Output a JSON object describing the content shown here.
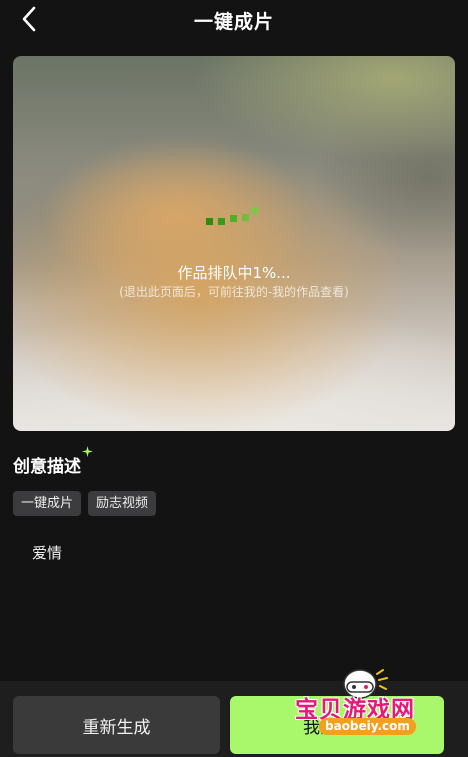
{
  "header": {
    "title": "一键成片",
    "back_icon": "chevron-left-icon"
  },
  "preview": {
    "status_text": "作品排队中1%...",
    "hint_text": "(退出此页面后，可前往我的-我的作品查看)",
    "progress_percent": 1,
    "loader_color": "#4caf24"
  },
  "creative": {
    "title": "创意描述",
    "sparkle_color": "#a9f76b",
    "tags": [
      "一键成片",
      "励志视频"
    ],
    "description": "爱情"
  },
  "actions": {
    "regenerate_label": "重新生成",
    "my_works_label": "我的作品"
  },
  "watermark": {
    "text": "宝贝游戏网",
    "url": "baobeiy.com"
  },
  "colors": {
    "background": "#131313",
    "accent": "#a9f76b",
    "watermark_pink": "#e6197a",
    "watermark_orange": "#f2a11e"
  }
}
